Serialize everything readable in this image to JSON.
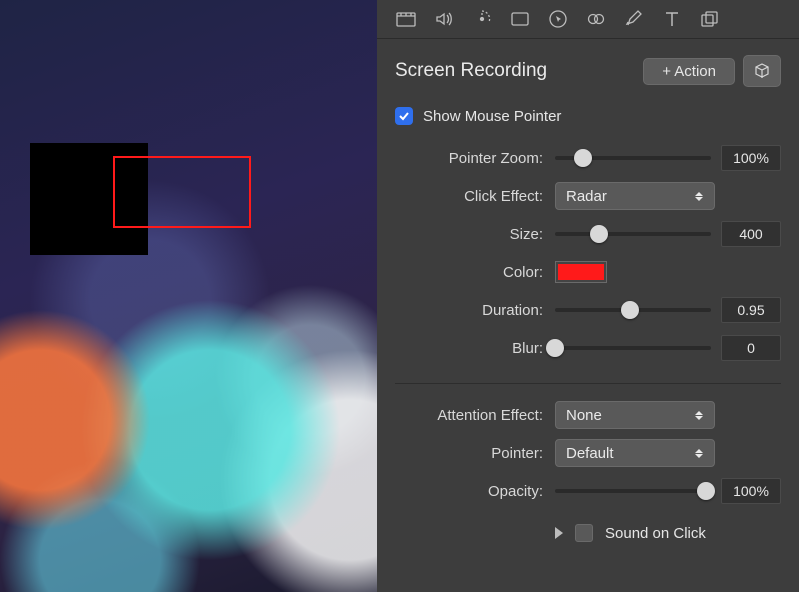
{
  "toolbar": {
    "icons": [
      "video-icon",
      "audio-icon",
      "radar-icon",
      "crop-icon",
      "cursor-icon",
      "link-icon",
      "pencil-icon",
      "text-icon",
      "copies-icon"
    ]
  },
  "header": {
    "title": "Screen Recording",
    "action_btn": "+ Action"
  },
  "show_pointer": {
    "label": "Show Mouse Pointer",
    "checked": true
  },
  "pointer_zoom": {
    "label": "Pointer Zoom:",
    "value": "100%",
    "pos": 0.18
  },
  "click_effect": {
    "label": "Click Effect:",
    "value": "Radar"
  },
  "size": {
    "label": "Size:",
    "value": "400",
    "pos": 0.28
  },
  "color": {
    "label": "Color:",
    "hex": "#ff1a1a"
  },
  "duration": {
    "label": "Duration:",
    "value": "0.95",
    "pos": 0.48
  },
  "blur": {
    "label": "Blur:",
    "value": "0",
    "pos": 0.0
  },
  "attention_effect": {
    "label": "Attention Effect:",
    "value": "None"
  },
  "pointer": {
    "label": "Pointer:",
    "value": "Default"
  },
  "opacity": {
    "label": "Opacity:",
    "value": "100%",
    "pos": 0.97
  },
  "sound_on_click": {
    "label": "Sound on Click",
    "checked": false
  }
}
